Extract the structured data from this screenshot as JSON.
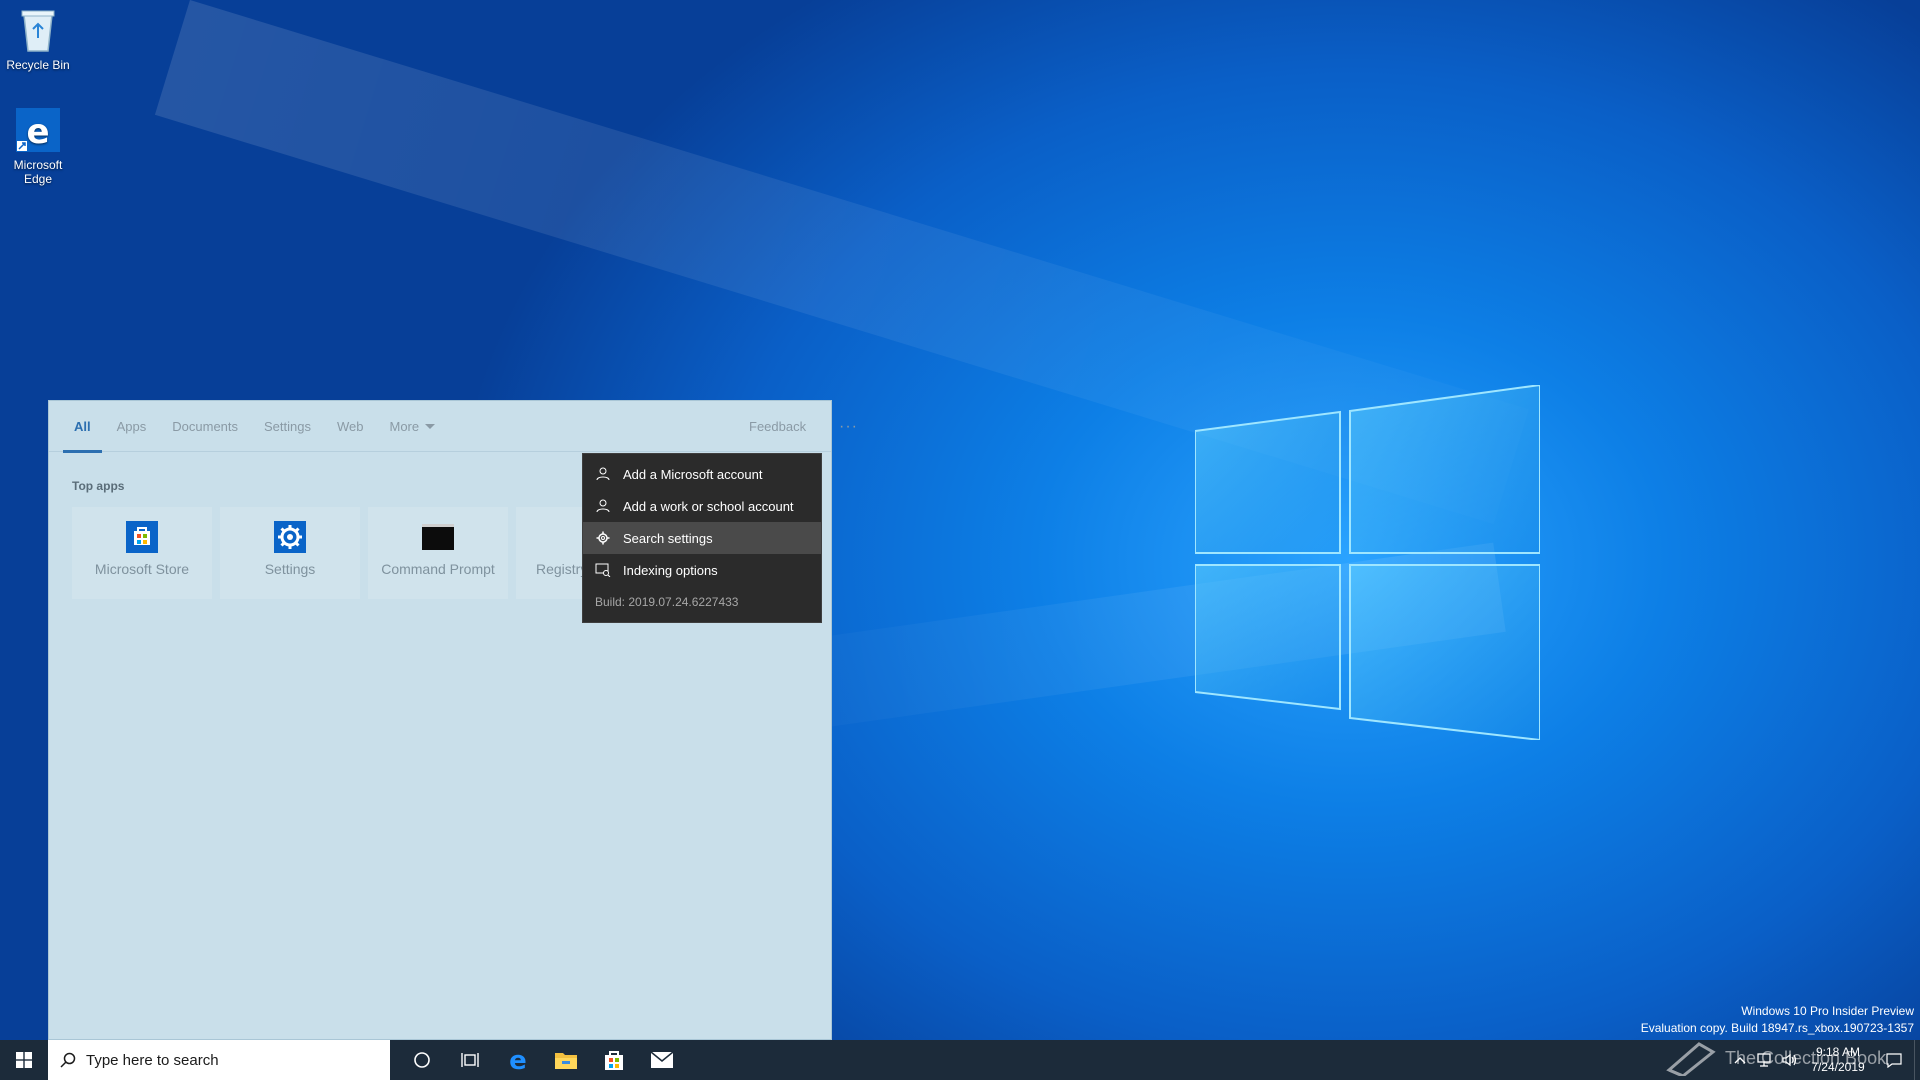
{
  "desktop": {
    "icons": [
      {
        "label": "Recycle Bin",
        "icon": "recycle-bin-icon"
      },
      {
        "label": "Microsoft Edge",
        "icon": "edge-icon"
      }
    ],
    "watermark_line1": "Windows 10 Pro Insider Preview",
    "watermark_line2": "Evaluation copy. Build 18947.rs_xbox.190723-1357"
  },
  "search_panel": {
    "tabs": [
      "All",
      "Apps",
      "Documents",
      "Settings",
      "Web",
      "More"
    ],
    "active_tab": "All",
    "feedback_label": "Feedback",
    "more_options_label": "···",
    "top_apps_label": "Top apps",
    "top_apps": [
      {
        "label": "Microsoft Store",
        "icon": "store-icon"
      },
      {
        "label": "Settings",
        "icon": "gear-icon"
      },
      {
        "label": "Command Prompt",
        "icon": "cmd-icon"
      },
      {
        "label": "Registry Editor",
        "icon": "registry-icon"
      }
    ]
  },
  "context_menu": {
    "items": [
      {
        "label": "Add a Microsoft account",
        "icon": "person-icon"
      },
      {
        "label": "Add a work or school account",
        "icon": "person-icon"
      },
      {
        "label": "Search settings",
        "icon": "gear-icon",
        "highlighted": true
      },
      {
        "label": "Indexing options",
        "icon": "indexing-icon"
      }
    ],
    "build": "Build: 2019.07.24.6227433"
  },
  "taskbar": {
    "search_placeholder": "Type here to search",
    "pinned": [
      "cortana-icon",
      "task-view-icon",
      "edge-icon",
      "file-explorer-icon",
      "store-icon",
      "mail-icon"
    ],
    "time": "9:18 AM",
    "date": "7/24/2019",
    "collector_text": "The Collection Book"
  },
  "colors": {
    "taskbar": "#1c2b3a",
    "panel": "#c9dfea",
    "accent": "#2c6fb0",
    "menu": "#2b2b2b",
    "menu_highlight": "#4a4a4a"
  }
}
